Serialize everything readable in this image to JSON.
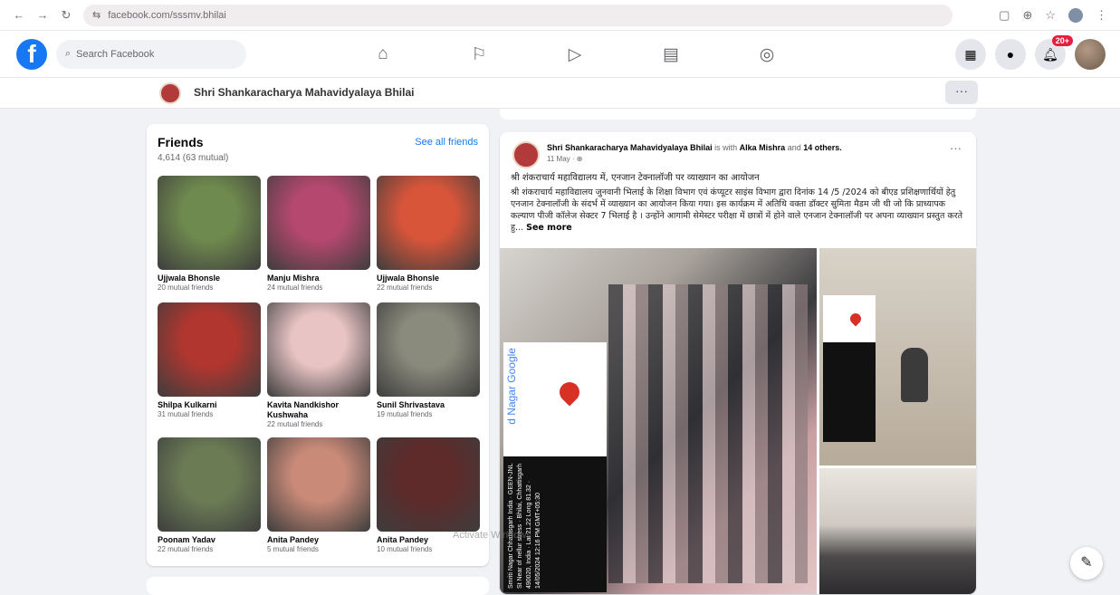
{
  "browser": {
    "url": "facebook.com/sssmv.bhilai"
  },
  "topbar": {
    "logo": "f",
    "search_placeholder": "Search Facebook",
    "notification_badge": "20+"
  },
  "page_header": {
    "name": "Shri Shankaracharya Mahavidyalaya Bhilai",
    "more": "···"
  },
  "friends": {
    "title": "Friends",
    "count": "4,614 (63 mutual)",
    "see_all": "See all friends",
    "items": [
      {
        "name": "Ujjwala Bhonsle",
        "mutual": "20 mutual friends",
        "color": "#6f8a4e"
      },
      {
        "name": "Manju Mishra",
        "mutual": "24 mutual friends",
        "color": "#b5486e"
      },
      {
        "name": "Ujjwala Bhonsle",
        "mutual": "22 mutual friends",
        "color": "#d9553a"
      },
      {
        "name": "Shilpa Kulkarni",
        "mutual": "31 mutual friends",
        "color": "#b1362f"
      },
      {
        "name": "Kavita Nandkishor Kushwaha",
        "mutual": "22 mutual friends",
        "color": "#e9c4c4"
      },
      {
        "name": "Sunil Shrivastava",
        "mutual": "19 mutual friends",
        "color": "#8b8b7d"
      },
      {
        "name": "Poonam Yadav",
        "mutual": "22 mutual friends",
        "color": "#6b7c55"
      },
      {
        "name": "Anita Pandey",
        "mutual": "5 mutual friends",
        "color": "#c98a78"
      },
      {
        "name": "Anita Pandey",
        "mutual": "10 mutual friends",
        "color": "#5e2a2a"
      }
    ]
  },
  "post": {
    "author": "Shri Shankaracharya Mahavidyalaya Bhilai",
    "with_text": "is with",
    "tagged": "Alka Mishra",
    "and_text": "and",
    "others": "14 others.",
    "date": "11 May · ⊕",
    "more": "···",
    "title": "श्री शंकराचार्य महाविद्यालय में, एनजान टेक्नालॉजी पर व्याख्यान का आयोजन",
    "body": "श्री शंकराचार्य महाविद्यालय जुनवानी भिलाई के शिक्षा विभाग एवं कंप्यूटर साइंस विभाग द्वारा दिनांक 14 /5 /2024 को बीएड प्रशिक्षणार्थियों हेतु एनजान टेक्नालॉजी के संदर्भ में व्याख्यान का आयोजन किया गया। इस कार्यक्रम में अतिथि वक्ता डॉक्टर सुमिता मैडम जी थी जो कि प्राध्यापक कल्याण पीजी कॉलेज सेक्टर 7 भिलाई है । उन्होंने आगामी सेमेस्टर परीक्षा में छात्रों में होने वाले एनजान टेक्नालॉजी पर अपना व्याख्यान प्रस्तुत करते हु...",
    "see_more": "See more",
    "map_text": "d Nagar Google",
    "gps_text": "Smriti Nagar Chhattisgarh India · GEEN-JNL St Near of nellur stress · Bhilai, Chhattisgarh 490020, India · Lat 21.22 Long 81.32 · 14/05/2024 12:16 PM GMT+05:30"
  },
  "watermark": "Activate Windows"
}
